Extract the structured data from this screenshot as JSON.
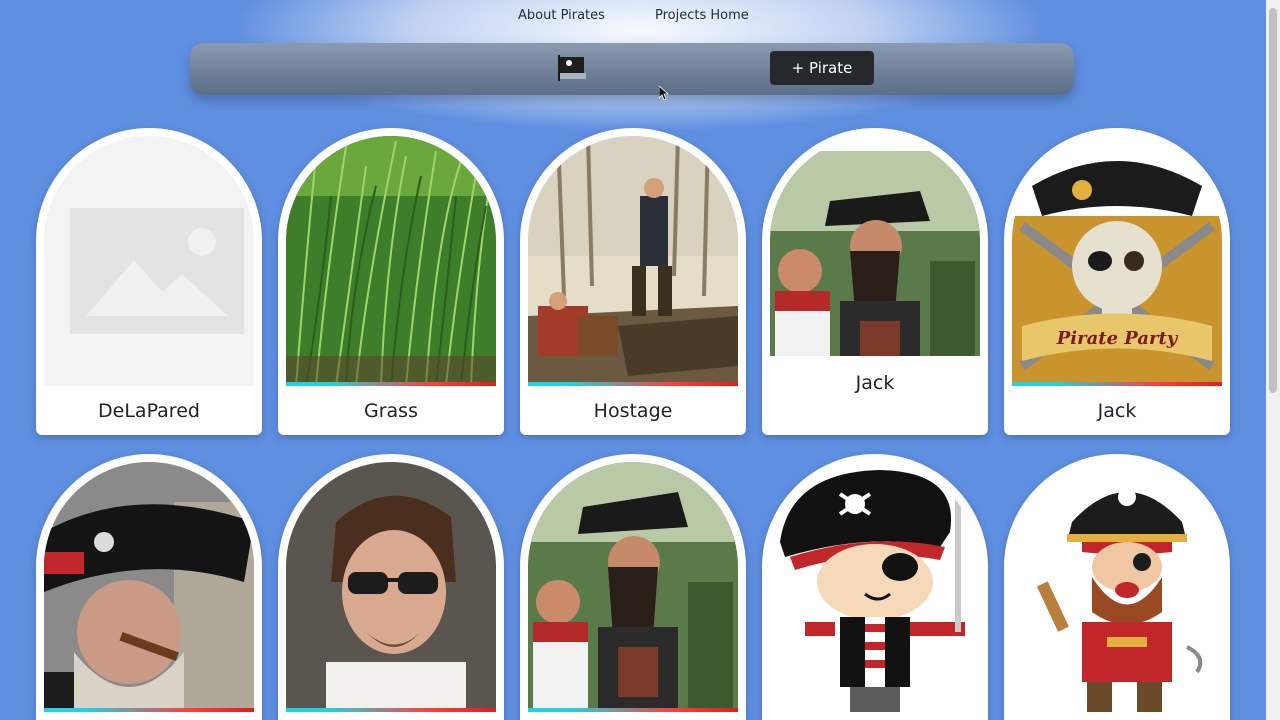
{
  "nav": {
    "about": "About Pirates",
    "projects": "Projects Home"
  },
  "toolbar": {
    "flag_icon": "pirate-flag-icon",
    "add_label": "+ Pirate"
  },
  "cards": [
    {
      "name": "DeLaPared",
      "image": "placeholder-image-icon"
    },
    {
      "name": "Grass",
      "image": "grass-photo"
    },
    {
      "name": "Hostage",
      "image": "hostage-painting"
    },
    {
      "name": "Jack",
      "image": "jack-costume-photo"
    },
    {
      "name": "Jack",
      "image": "pirate-party-skull-logo"
    },
    {
      "name": "",
      "image": "pirate-cigar-photo"
    },
    {
      "name": "",
      "image": "actor-sunglasses-photo"
    },
    {
      "name": "",
      "image": "jack-costume-photo"
    },
    {
      "name": "",
      "image": "cartoon-pirate-boy"
    },
    {
      "name": "",
      "image": "cartoon-pirate-captain"
    }
  ],
  "colors": {
    "background": "#5f8fe0",
    "button": "#26282c",
    "accent_cyan": "#1fd3e0",
    "accent_red": "#e21d1d"
  }
}
